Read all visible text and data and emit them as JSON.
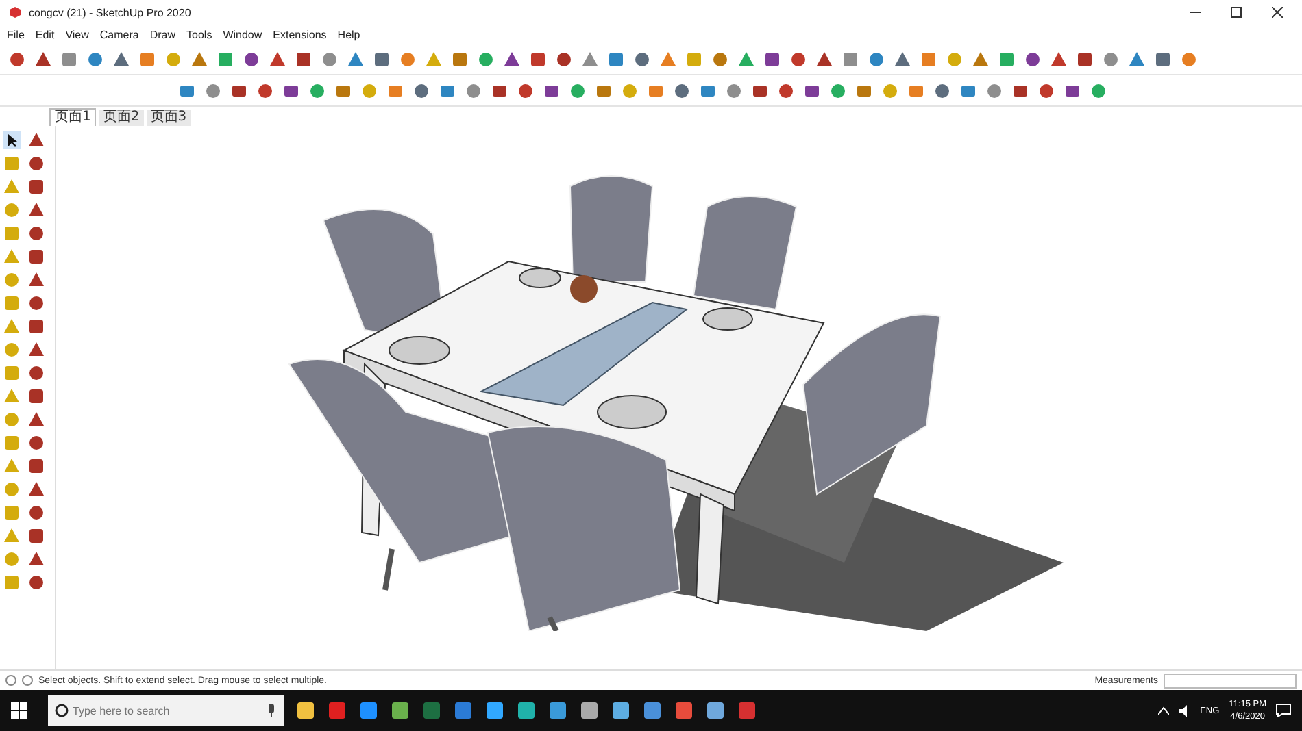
{
  "window": {
    "title": "congcv (21) - SketchUp Pro 2020"
  },
  "menu": [
    "File",
    "Edit",
    "View",
    "Camera",
    "Draw",
    "Tools",
    "Window",
    "Extensions",
    "Help"
  ],
  "tabs": [
    {
      "label": "页面1",
      "selected": true
    },
    {
      "label": "页面2",
      "selected": false
    },
    {
      "label": "页面3",
      "selected": false
    }
  ],
  "status_bar": {
    "hint": "Select objects. Shift to extend select. Drag mouse to select multiple.",
    "measurements_label": "Measurements"
  },
  "taskbar": {
    "search": {
      "placeholder": "Type here to search"
    },
    "language": "ENG",
    "time": "11:15 PM",
    "date": "4/6/2020"
  }
}
